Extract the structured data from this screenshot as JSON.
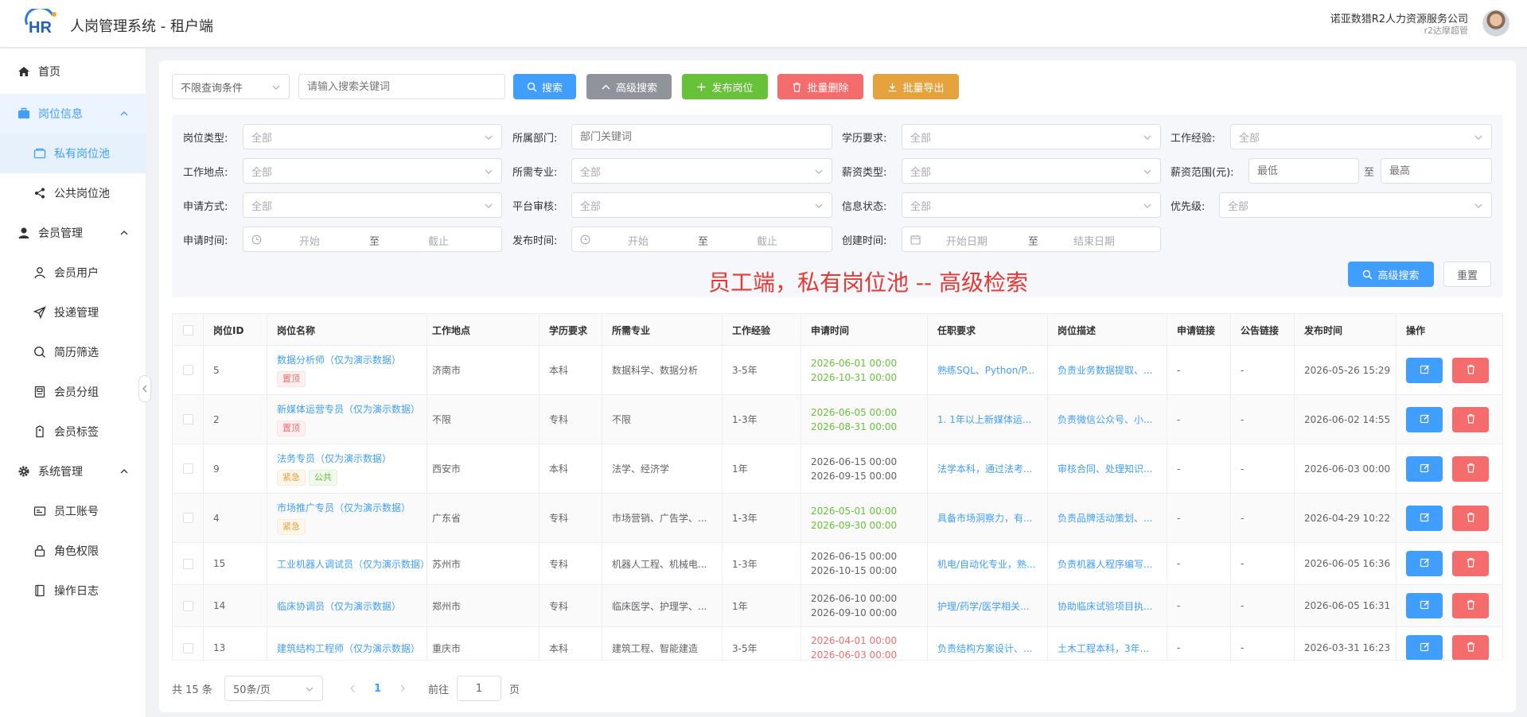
{
  "header": {
    "title": "人岗管理系统 - 租户端",
    "logo_text": "HR",
    "company": "诺亚数猎R2人力资源服务公司",
    "role": "r2达摩超管"
  },
  "sidebar": {
    "items": [
      {
        "label": "首页",
        "icon": "home-icon"
      },
      {
        "label": "岗位信息",
        "icon": "briefcase-icon"
      },
      {
        "label": "私有岗位池",
        "icon": "folder-icon"
      },
      {
        "label": "公共岗位池",
        "icon": "share-icon"
      },
      {
        "label": "会员管理",
        "icon": "user-icon"
      },
      {
        "label": "会员用户",
        "icon": "user-outline-icon"
      },
      {
        "label": "投递管理",
        "icon": "send-icon"
      },
      {
        "label": "简历筛选",
        "icon": "search-icon"
      },
      {
        "label": "会员分组",
        "icon": "group-icon"
      },
      {
        "label": "会员标签",
        "icon": "tag-icon"
      },
      {
        "label": "系统管理",
        "icon": "gear-icon"
      },
      {
        "label": "员工账号",
        "icon": "id-card-icon"
      },
      {
        "label": "角色权限",
        "icon": "lock-icon"
      },
      {
        "label": "操作日志",
        "icon": "notebook-icon"
      }
    ]
  },
  "toolbar": {
    "condition_select": "不限查询条件",
    "search_placeholder": "请输入搜索关键词",
    "search": "搜索",
    "advanced": "高级搜索",
    "publish": "发布岗位",
    "batch_delete": "批量删除",
    "batch_export": "批量导出"
  },
  "filters": {
    "job_type": {
      "label": "岗位类型:",
      "value": "全部"
    },
    "department": {
      "label": "所属部门:",
      "placeholder": "部门关键词"
    },
    "education": {
      "label": "学历要求:",
      "value": "全部"
    },
    "experience": {
      "label": "工作经验:",
      "value": "全部"
    },
    "location": {
      "label": "工作地点:",
      "value": "全部"
    },
    "major": {
      "label": "所需专业:",
      "value": "全部"
    },
    "salary_type": {
      "label": "薪资类型:",
      "value": "全部"
    },
    "salary_range": {
      "label": "薪资范围(元):",
      "min": "最低",
      "to": "至",
      "max": "最高"
    },
    "apply_method": {
      "label": "申请方式:",
      "value": "全部"
    },
    "platform_review": {
      "label": "平台审核:",
      "value": "全部"
    },
    "info_status": {
      "label": "信息状态:",
      "value": "全部"
    },
    "priority": {
      "label": "优先级:",
      "value": "全部"
    },
    "apply_time": {
      "label": "申请时间:",
      "start": "开始",
      "to": "至",
      "end": "截止"
    },
    "publish_time": {
      "label": "发布时间:",
      "start": "开始",
      "to": "至",
      "end": "截止"
    },
    "create_time": {
      "label": "创建时间:",
      "start": "开始日期",
      "to": "至",
      "end": "结束日期"
    },
    "advanced_search": "高级搜索",
    "reset": "重置"
  },
  "watermark": "员工端，私有岗位池  -- 高级检索",
  "table": {
    "headers": [
      "岗位ID",
      "岗位名称",
      "工作地点",
      "学历要求",
      "所需专业",
      "工作经验",
      "申请时间",
      "任职要求",
      "岗位描述",
      "申请链接",
      "公告链接",
      "发布时间",
      "操作"
    ],
    "rows": [
      {
        "id": "5",
        "name": "数据分析师（仅为演示数据）",
        "tags": [
          {
            "t": "置顶",
            "c": "red"
          }
        ],
        "location": "济南市",
        "edu": "本科",
        "major": "数据科学、数据分析",
        "exp": "3-5年",
        "apply_start": "2026-06-01 00:00",
        "apply_end": "2026-10-31 00:00",
        "time_color": "green",
        "req": "熟练SQL、Python/P...",
        "desc": "负责业务数据提取、...",
        "apply_link": "-",
        "notice_link": "-",
        "publish": "2026-05-26 15:29"
      },
      {
        "id": "2",
        "name": "新媒体运营专员（仅为演示数据）",
        "tags": [
          {
            "t": "置顶",
            "c": "red"
          }
        ],
        "location": "不限",
        "edu": "专科",
        "major": "不限",
        "exp": "1-3年",
        "apply_start": "2026-06-05 00:00",
        "apply_end": "2026-08-31 00:00",
        "time_color": "green",
        "req": "1. 1年以上新媒体运...",
        "desc": "负责微信公众号、小...",
        "apply_link": "-",
        "notice_link": "-",
        "publish": "2026-06-02 14:55"
      },
      {
        "id": "9",
        "name": "法务专员（仅为演示数据）",
        "tags": [
          {
            "t": "紧急",
            "c": "orange"
          },
          {
            "t": "公共",
            "c": "green"
          }
        ],
        "location": "西安市",
        "edu": "本科",
        "major": "法学、经济学",
        "exp": "1年",
        "apply_start": "2026-06-15 00:00",
        "apply_end": "2026-09-15 00:00",
        "time_color": "dark",
        "req": "法学本科，通过法考...",
        "desc": "审核合同、处理知识...",
        "apply_link": "-",
        "notice_link": "-",
        "publish": "2026-06-03 00:00"
      },
      {
        "id": "4",
        "name": "市场推广专员（仅为演示数据）",
        "tags": [
          {
            "t": "紧急",
            "c": "orange"
          }
        ],
        "location": "广东省",
        "edu": "专科",
        "major": "市场营销、广告学、...",
        "exp": "1-3年",
        "apply_start": "2026-05-01 00:00",
        "apply_end": "2026-09-30 00:00",
        "time_color": "green",
        "req": "具备市场洞察力，有...",
        "desc": "负责品牌活动策划、...",
        "apply_link": "-",
        "notice_link": "-",
        "publish": "2026-04-29 10:22"
      },
      {
        "id": "15",
        "name": "工业机器人调试员（仅为演示数据）",
        "tags": [],
        "location": "苏州市",
        "edu": "专科",
        "major": "机器人工程、机械电...",
        "exp": "1-3年",
        "apply_start": "2026-06-15 00:00",
        "apply_end": "2026-10-15 00:00",
        "time_color": "dark",
        "req": "机电/自动化专业，熟...",
        "desc": "负责机器人程序编写...",
        "apply_link": "-",
        "notice_link": "-",
        "publish": "2026-06-05 16:36"
      },
      {
        "id": "14",
        "name": "临床协调员（仅为演示数据）",
        "tags": [],
        "location": "郑州市",
        "edu": "专科",
        "major": "临床医学、护理学、...",
        "exp": "1年",
        "apply_start": "2026-06-10 00:00",
        "apply_end": "2026-09-10 00:00",
        "time_color": "dark",
        "req": "护理/药学/医学相关...",
        "desc": "协助临床试验项目执...",
        "apply_link": "-",
        "notice_link": "-",
        "publish": "2026-06-05 16:31"
      },
      {
        "id": "13",
        "name": "建筑结构工程师（仅为演示数据）",
        "tags": [],
        "location": "重庆市",
        "edu": "本科",
        "major": "建筑工程、智能建造",
        "exp": "3-5年",
        "apply_start": "2026-04-01 00:00",
        "apply_end": "2026-06-03 00:00",
        "time_color": "red",
        "req": "负责结构方案设计、...",
        "desc": "土木工程本科，3年...",
        "apply_link": "-",
        "notice_link": "-",
        "publish": "2026-03-31 16:23"
      }
    ]
  },
  "pagination": {
    "total": "共 15 条",
    "page_size": "50条/页",
    "current": "1",
    "goto": "前往",
    "goto_value": "1",
    "page_unit": "页"
  },
  "colors": {
    "primary": "#409eff",
    "success": "#67c23a",
    "danger": "#f56c6c",
    "warning": "#e6a23c",
    "info": "#909399"
  }
}
